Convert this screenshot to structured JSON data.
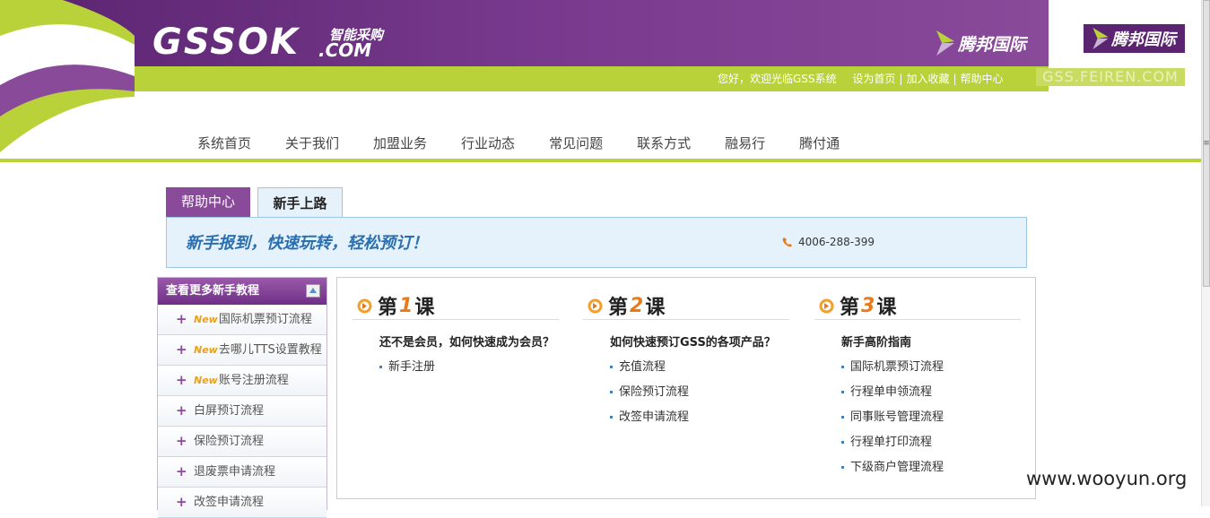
{
  "header": {
    "logo_main": "GSSOK",
    "logo_sub_top": "智能采购",
    "logo_sub_bottom": ".COM",
    "brand": "腾邦国际",
    "welcome": "您好，欢迎光临GSS系统",
    "links": [
      "设为首页",
      "加入收藏",
      "帮助中心"
    ],
    "right_brand": "腾邦国际",
    "right_url": "GSS.FEIREN.COM"
  },
  "nav": {
    "items": [
      "系统首页",
      "关于我们",
      "加盟业务",
      "行业动态",
      "常见问题",
      "联系方式",
      "融易行",
      "腾付通"
    ]
  },
  "tabs": {
    "help": "帮助中心",
    "beginner": "新手上路"
  },
  "banner": {
    "slogan": "新手报到，快速玩转，轻松预订！",
    "phone": "4006-288-399"
  },
  "sidebar": {
    "title": "查看更多新手教程",
    "new_tag": "New",
    "items": [
      {
        "label": "国际机票预订流程",
        "is_new": true
      },
      {
        "label": "去哪儿TTS设置教程",
        "is_new": true
      },
      {
        "label": "账号注册流程",
        "is_new": true
      },
      {
        "label": "白屏预订流程",
        "is_new": false
      },
      {
        "label": "保险预订流程",
        "is_new": false
      },
      {
        "label": "退废票申请流程",
        "is_new": false
      },
      {
        "label": "改签申请流程",
        "is_new": false
      }
    ]
  },
  "lessons": [
    {
      "prefix": "第",
      "num": "1",
      "suffix": "课",
      "question": "还不是会员，如何快速成为会员？",
      "items": [
        "新手注册"
      ]
    },
    {
      "prefix": "第",
      "num": "2",
      "suffix": "课",
      "question": "如何快速预订GSS的各项产品？",
      "items": [
        "充值流程",
        "保险预订流程",
        "改签申请流程"
      ]
    },
    {
      "prefix": "第",
      "num": "3",
      "suffix": "课",
      "question": "新手高阶指南",
      "items": [
        "国际机票预订流程",
        "行程单申领流程",
        "同事账号管理流程",
        "行程单打印流程",
        "下级商户管理流程"
      ]
    }
  ],
  "watermark": "www.wooyun.org",
  "colors": {
    "purple": "#7a3b8f",
    "green": "#b9d23a",
    "orange": "#e87a1a",
    "light_blue": "#e6f2fb"
  }
}
